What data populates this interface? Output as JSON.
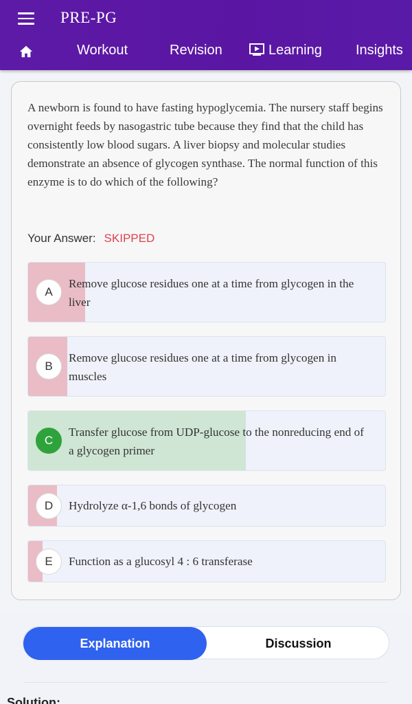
{
  "header": {
    "title": "PRE-PG",
    "nav": [
      "Workout",
      "Revision",
      "Learning",
      "Insights"
    ]
  },
  "question": {
    "text": "A newborn is found to have fasting hypoglycemia. The nursery staff begins overnight feeds by nasogastric tube because they find that the child has consistently low blood sugars. A liver biopsy and molecular studies demonstrate an absence of glycogen synthase. The normal function of this enzyme is to do which of the following?",
    "answer_label": "Your Answer:",
    "answer_value": "SKIPPED"
  },
  "options": [
    {
      "letter": "A",
      "text": "Remove glucose residues one at a time from glycogen in the liver",
      "percent": 16,
      "status": "incorrect"
    },
    {
      "letter": "B",
      "text": "Remove glucose residues one at a time from glycogen in muscles",
      "percent": 11,
      "status": "incorrect"
    },
    {
      "letter": "C",
      "text": "Transfer glucose from UDP-glucose to the nonreducing end of a glycogen primer",
      "percent": 61,
      "status": "correct"
    },
    {
      "letter": "D",
      "text": "Hydrolyze α-1,6 bonds of glycogen",
      "percent": 8,
      "status": "incorrect"
    },
    {
      "letter": "E",
      "text": "Function as a glucosyl 4 : 6 transferase",
      "percent": 4,
      "status": "incorrect"
    }
  ],
  "tabs": {
    "explanation": "Explanation",
    "discussion": "Discussion"
  },
  "solution_heading": "Solution:",
  "colors": {
    "header": "#5a16a3",
    "correct": "#2fa33b",
    "incorrect_bar": "#e9bcc6",
    "correct_bar": "#cfe6d4",
    "skipped": "#e0414c",
    "active_tab": "#2f62ee"
  }
}
